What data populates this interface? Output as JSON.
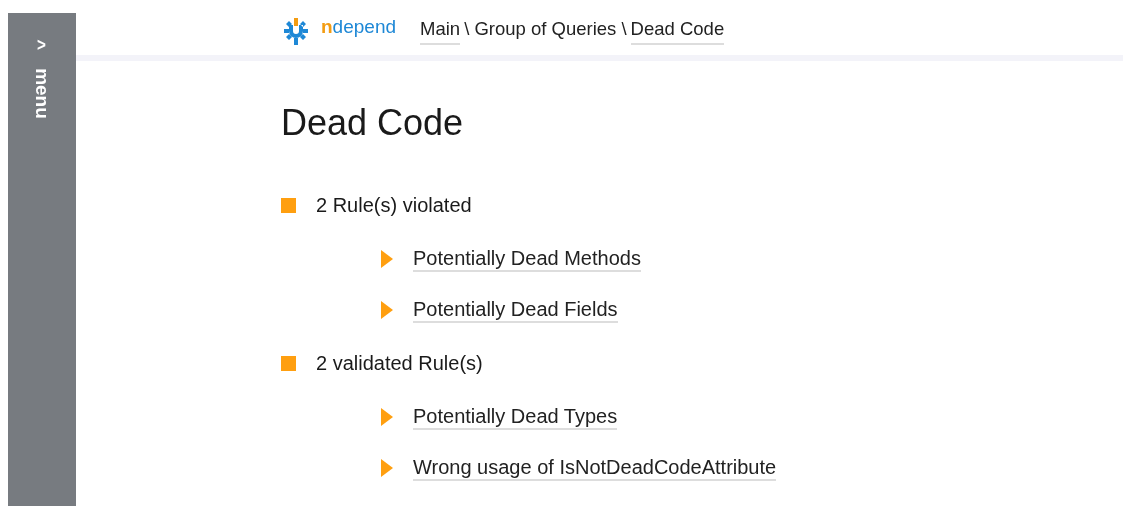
{
  "sidebar": {
    "toggle": ">",
    "label": "menu"
  },
  "logo": {
    "accent": "n",
    "rest": "depend"
  },
  "breadcrumb": [
    {
      "kind": "link",
      "text": "Main"
    },
    {
      "kind": "text",
      "text": "\\ Group of Queries \\"
    },
    {
      "kind": "link",
      "text": "Dead Code"
    }
  ],
  "title": "Dead Code",
  "groups": [
    {
      "label": "2 Rule(s) violated",
      "rules": [
        "Potentially Dead Methods",
        "Potentially Dead Fields"
      ]
    },
    {
      "label": "2 validated Rule(s)",
      "rules": [
        "Potentially Dead Types",
        "Wrong usage of IsNotDeadCodeAttribute"
      ]
    }
  ]
}
